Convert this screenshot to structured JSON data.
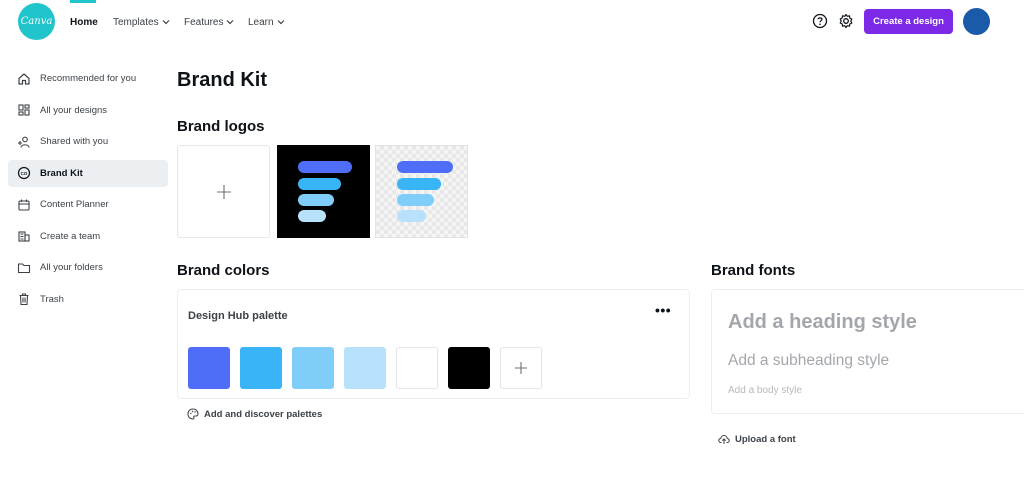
{
  "topbar": {
    "logo_text": "Canva",
    "nav": [
      {
        "label": "Home"
      },
      {
        "label": "Templates"
      },
      {
        "label": "Features"
      },
      {
        "label": "Learn"
      }
    ],
    "create_label": "Create a design",
    "accent_color": "#20c4cb",
    "create_color": "#7d2ae8"
  },
  "sidebar": {
    "items": [
      {
        "label": "Recommended for you",
        "icon": "home-icon"
      },
      {
        "label": "All your designs",
        "icon": "grid-icon"
      },
      {
        "label": "Shared with you",
        "icon": "shared-people-icon"
      },
      {
        "label": "Brand Kit",
        "icon": "brand-kit-icon"
      },
      {
        "label": "Content Planner",
        "icon": "calendar-icon"
      },
      {
        "label": "Create a team",
        "icon": "team-building-icon"
      },
      {
        "label": "All your folders",
        "icon": "folder-icon"
      },
      {
        "label": "Trash",
        "icon": "trash-icon"
      }
    ]
  },
  "main": {
    "title": "Brand Kit",
    "logos": {
      "title": "Brand logos"
    },
    "colors": {
      "title": "Brand colors",
      "palette_name": "Design Hub palette",
      "swatches": [
        "#4f6ef7",
        "#38b4f7",
        "#80cdf9",
        "#b8e2fb",
        "#ffffff",
        "#000000"
      ],
      "discover_label": "Add and discover palettes"
    },
    "fonts": {
      "title": "Brand fonts",
      "heading": "Add a heading style",
      "subheading": "Add a subheading style",
      "body": "Add a body style",
      "upload_label": "Upload a font"
    }
  }
}
